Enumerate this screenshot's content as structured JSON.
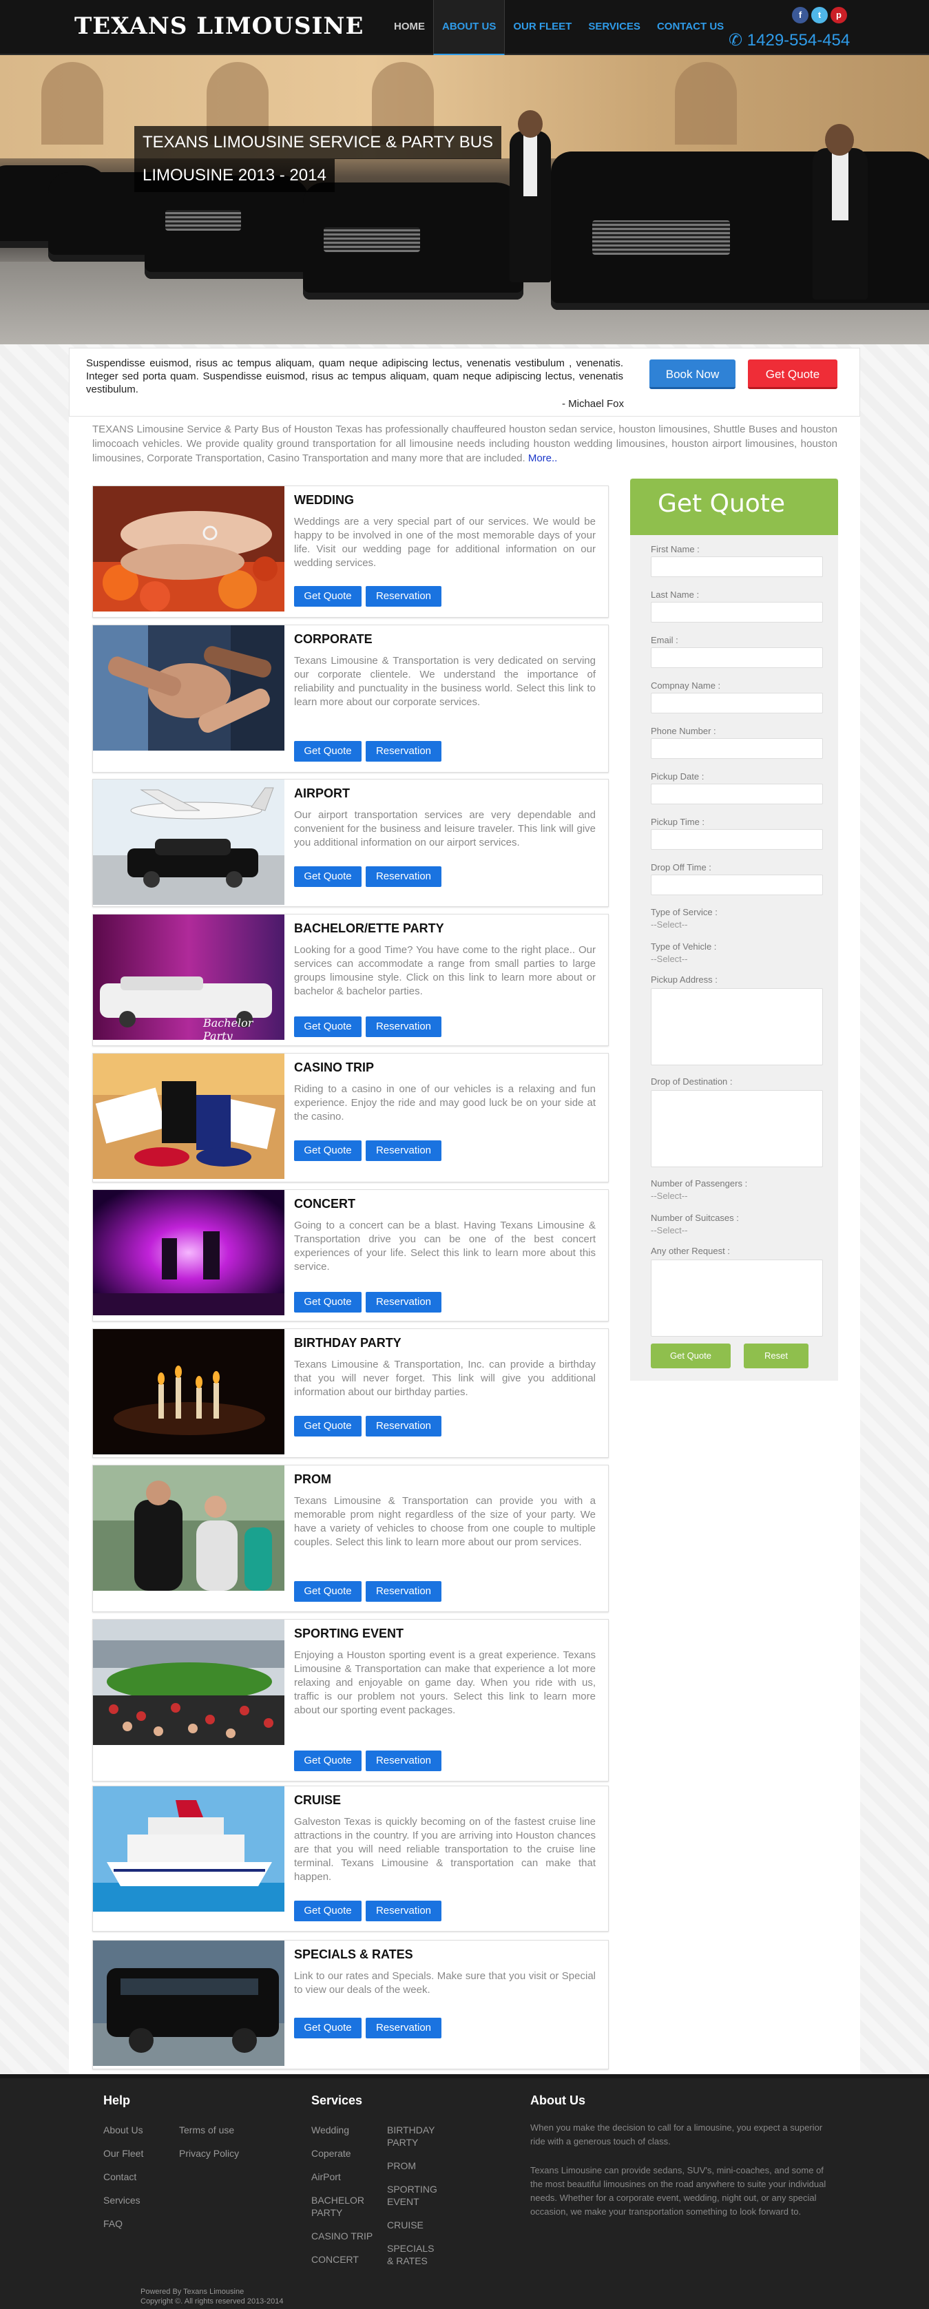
{
  "header": {
    "logo": "TEXANS LIMOUSINE",
    "nav": [
      "HOME",
      "ABOUT US",
      "OUR FLEET",
      "SERVICES",
      "CONTACT US"
    ],
    "social": [
      "f",
      "t",
      "p"
    ],
    "phone": "✆ 1429-554-454"
  },
  "hero": {
    "title_line1": "TEXANS LIMOUSINE SERVICE & PARTY BUS",
    "title_line2": "LIMOUSINE 2013 - 2014"
  },
  "quote": {
    "text": "Suspendisse euismod, risus ac tempus aliquam, quam neque adipiscing lectus, venenatis vestibulum , venenatis. Integer sed porta quam. Suspendisse euismod, risus ac tempus aliquam, quam neque adipiscing lectus, venenatis vestibulum.",
    "author": "- Michael Fox",
    "book_label": "Book Now",
    "getquote_label": "Get Quote"
  },
  "intro": {
    "text": "TEXANS Limousine Service & Party Bus of Houston Texas has professionally chauffeured houston sedan service, houston limousines, Shuttle Buses and houston limocoach vehicles. We provide quality ground transportation for all limousine needs including houston wedding limousines, houston airport limousines, houston limousines, Corporate Transportation, Casino Transportation and many more that are included.",
    "more": "More.."
  },
  "services": [
    {
      "title": "WEDDING",
      "text": "Weddings are a very special part of our services. We would be happy to be involved in one of the most memorable days of your life. Visit our wedding page for additional information on our wedding services.",
      "btn1": "Get Quote",
      "btn2": "Reservation"
    },
    {
      "title": "CORPORATE",
      "text": "Texans Limousine & Transportation is very dedicated on serving our corporate clientele. We understand the importance of reliability and punctuality in the business world. Select this link to learn more about our corporate services.",
      "btn1": "Get Quote",
      "btn2": "Reservation"
    },
    {
      "title": "AIRPORT",
      "text": "Our airport transportation services are very dependable and convenient for the business and leisure traveler. This link will give you additional information on our airport services.",
      "btn1": "Get Quote",
      "btn2": "Reservation"
    },
    {
      "title": "BACHELOR/ETTE PARTY",
      "text": "Looking for a good Time? You have come to the right place.. Our services can accommodate a range from small parties to large groups limousine style. Click on this link to learn more about or bachelor & bachelor parties.",
      "btn1": "Get Quote",
      "btn2": "Reservation",
      "img_caption": "Bachelor Party"
    },
    {
      "title": "CASINO TRIP",
      "text": "Riding to a casino in one of our vehicles is a relaxing and fun experience. Enjoy the ride and may good luck be on your side at the casino.",
      "btn1": "Get Quote",
      "btn2": "Reservation"
    },
    {
      "title": "CONCERT",
      "text": "Going to a concert can be a blast. Having Texans Limousine & Transportation drive you can be one of the best concert experiences of your life. Select this link to learn more about this service.",
      "btn1": "Get Quote",
      "btn2": "Reservation"
    },
    {
      "title": "BIRTHDAY PARTY",
      "text": "Texans Limousine & Transportation, Inc. can provide a birthday that you will never forget. This link will give you additional information about our birthday parties.",
      "btn1": "Get Quote",
      "btn2": "Reservation"
    },
    {
      "title": "PROM",
      "text": "Texans Limousine & Transportation can provide you with a memorable prom night regardless of the size of your party. We have a variety of vehicles to choose from one couple to multiple couples. Select this link to learn more about our prom services.",
      "btn1": "Get Quote",
      "btn2": "Reservation"
    },
    {
      "title": "SPORTING EVENT",
      "text": "Enjoying a Houston sporting event is a great experience. Texans Limousine & Transportation can make that experience a lot more relaxing and enjoyable on game day. When you ride with us, traffic is our problem not yours. Select this link to learn more about our sporting event packages.",
      "btn1": "Get Quote",
      "btn2": "Reservation"
    },
    {
      "title": "CRUISE",
      "text": "Galveston Texas is quickly becoming on of the fastest cruise line attractions in the country. If you are arriving into Houston chances are that you will need reliable transportation to the cruise line terminal. Texans Limousine & transportation can make that happen.",
      "btn1": "Get Quote",
      "btn2": "Reservation"
    },
    {
      "title": "SPECIALS & RATES",
      "text": "Link to our rates and Specials. Make sure that you visit or Special to view our deals of the week.",
      "btn1": "Get Quote",
      "btn2": "Reservation"
    }
  ],
  "form": {
    "title": "Get Quote",
    "fields": [
      "First Name :",
      "Last Name :",
      "Email :",
      "Compnay Name :",
      "Phone Number :",
      "Pickup Date :",
      "Pickup Time :",
      "Drop Off Time :"
    ],
    "type_service_label": "Type of Service :",
    "type_vehicle_label": "Type of Vehicle :",
    "pickup_address_label": "Pickup Address :",
    "drop_destination_label": "Drop of Destination :",
    "passengers_label": "Number of Passengers :",
    "suitcases_label": "Number of Suitcases :",
    "other_request_label": "Any other Request :",
    "select_placeholder": "--Select--",
    "submit_label": "Get Quote",
    "reset_label": "Reset"
  },
  "footer": {
    "help_title": "Help",
    "help_col1": [
      "About Us",
      "Our Fleet",
      "Contact",
      "Services",
      "FAQ"
    ],
    "help_col2": [
      "Terms of use",
      "Privacy Policy"
    ],
    "services_title": "Services",
    "services_col1": [
      "Wedding",
      "Coperate",
      "AirPort",
      "BACHELOR PARTY",
      "CASINO TRIP",
      "CONCERT"
    ],
    "services_col2": [
      "BIRTHDAY PARTY",
      "PROM",
      "SPORTING EVENT",
      "CRUISE",
      "SPECIALS & RATES"
    ],
    "about_title": "About Us",
    "about_p1": "When you make the decision to call for a limousine, you expect a superior ride with a generous touch of class.",
    "about_p2": "Texans Limousine can provide sedans, SUV's, mini-coaches, and some of the most beautiful limousines on the road anywhere to suite your individual needs. Whether for a corporate event, wedding, night out, or any special occasion, we make your transportation something to look forward to.",
    "powered": "Powered By Texans Limousine",
    "copyright": "Copyright ©. All rights reserved 2013-2014"
  }
}
